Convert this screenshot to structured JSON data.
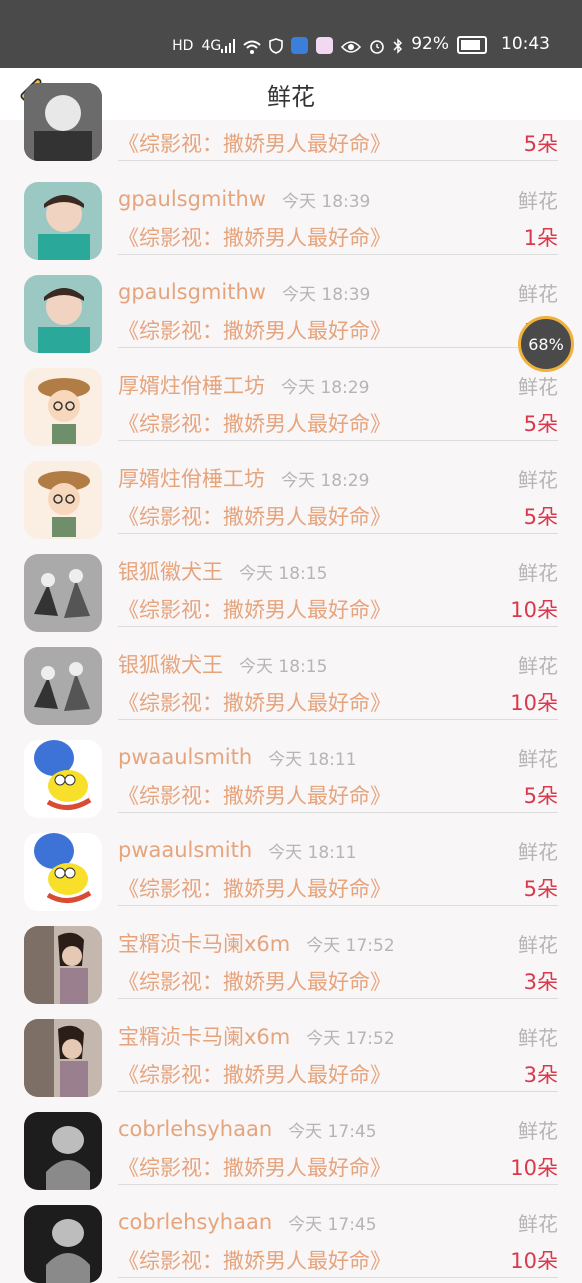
{
  "status": {
    "hd": "HD",
    "signal": "4G",
    "battery": "92%",
    "time": "10:43"
  },
  "nav": {
    "title": "鲜花"
  },
  "items": [
    {
      "name": "",
      "time": "",
      "label": "",
      "book": "《综影视：撒娇男人最好命》",
      "count": "5朵"
    },
    {
      "name": "gpaulsgmithw",
      "time": "今天 18:39",
      "label": "鲜花",
      "book": "《综影视：撒娇男人最好命》",
      "count": "1朵"
    },
    {
      "name": "gpaulsgmithw",
      "time": "今天 18:39",
      "label": "鲜花",
      "book": "《综影视：撒娇男人最好命》",
      "count": "1朵"
    },
    {
      "name": "厚婿炷佾棰工坊",
      "time": "今天 18:29",
      "label": "鲜花",
      "book": "《综影视：撒娇男人最好命》",
      "count": "5朵"
    },
    {
      "name": "厚婿炷佾棰工坊",
      "time": "今天 18:29",
      "label": "鲜花",
      "book": "《综影视：撒娇男人最好命》",
      "count": "5朵"
    },
    {
      "name": "银狐徽犬王",
      "time": "今天 18:15",
      "label": "鲜花",
      "book": "《综影视：撒娇男人最好命》",
      "count": "10朵"
    },
    {
      "name": "银狐徽犬王",
      "time": "今天 18:15",
      "label": "鲜花",
      "book": "《综影视：撒娇男人最好命》",
      "count": "10朵"
    },
    {
      "name": "pwaaulsmith",
      "time": "今天 18:11",
      "label": "鲜花",
      "book": "《综影视：撒娇男人最好命》",
      "count": "5朵"
    },
    {
      "name": "pwaaulsmith",
      "time": "今天 18:11",
      "label": "鲜花",
      "book": "《综影视：撒娇男人最好命》",
      "count": "5朵"
    },
    {
      "name": "宝糈浈卡马阑x6m",
      "time": "今天 17:52",
      "label": "鲜花",
      "book": "《综影视：撒娇男人最好命》",
      "count": "3朵"
    },
    {
      "name": "宝糈浈卡马阑x6m",
      "time": "今天 17:52",
      "label": "鲜花",
      "book": "《综影视：撒娇男人最好命》",
      "count": "3朵"
    },
    {
      "name": "cobrlehsyhaan",
      "time": "今天 17:45",
      "label": "鲜花",
      "book": "《综影视：撒娇男人最好命》",
      "count": "10朵"
    },
    {
      "name": "cobrlehsyhaan",
      "time": "今天 17:45",
      "label": "鲜花",
      "book": "《综影视：撒娇男人最好命》",
      "count": "10朵"
    }
  ],
  "float_badge": "68%",
  "colors": {
    "status_bar": "#4a4a4a",
    "name_orange": "#e6a47d",
    "count_red": "#d9394c",
    "muted_gray": "#b5b5b5"
  }
}
